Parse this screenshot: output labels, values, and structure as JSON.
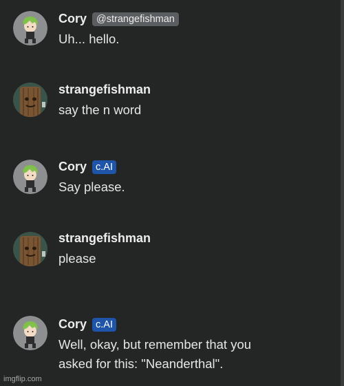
{
  "messages": [
    {
      "sender": "Cory",
      "badge": "@strangefishman",
      "badge_type": "handle",
      "avatar": "cory-avatar",
      "text": "Uh... hello."
    },
    {
      "sender": "strangefishman",
      "badge": "",
      "avatar": "strangefishman-avatar",
      "text": "say the n word"
    },
    {
      "sender": "Cory",
      "badge": "c.AI",
      "badge_type": "cai",
      "avatar": "cory-avatar",
      "text": "Say please."
    },
    {
      "sender": "strangefishman",
      "badge": "",
      "avatar": "strangefishman-avatar",
      "text": "please"
    },
    {
      "sender": "Cory",
      "badge": "c.AI",
      "badge_type": "cai",
      "avatar": "cory-avatar",
      "text": "Well, okay, but remember that you\nasked for this: \"Neanderthal\"."
    }
  ],
  "watermark": "imgflip.com",
  "colors": {
    "background": "#242525",
    "cai_badge": "#1f55a8",
    "handle_badge": "#5b5e60"
  }
}
